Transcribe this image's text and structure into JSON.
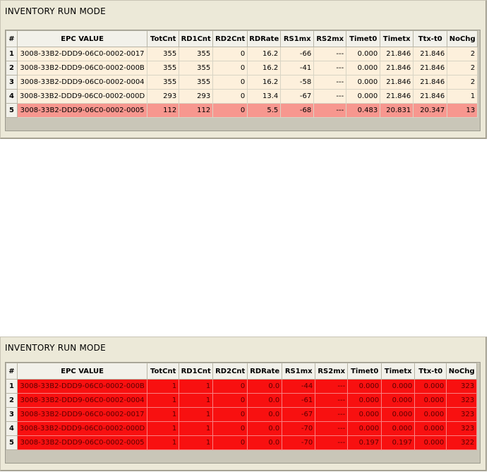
{
  "columns": [
    "#",
    "EPC VALUE",
    "TotCnt",
    "RD1Cnt",
    "RD2Cnt",
    "RDRate",
    "RS1mx",
    "RS2mx",
    "Timet0",
    "Timetx",
    "Ttx-t0",
    "NoChg"
  ],
  "colors": {
    "panel_bg": "#ece9d8",
    "row_bg": "#fdf0dc",
    "alert_row_bg": "#f7978f",
    "stale_row_bg": "#f81010"
  },
  "top_panel": {
    "title": "INVENTORY RUN MODE",
    "rows": [
      {
        "n": "1",
        "epc": "3008-33B2-DDD9-06C0-0002-0017",
        "totcnt": "355",
        "rd1": "355",
        "rd2": "0",
        "rdrate": "16.2",
        "rs1": "-66",
        "rs2": "---",
        "t0": "0.000",
        "tx": "21.846",
        "ttx": "21.846",
        "nochg": "2"
      },
      {
        "n": "2",
        "epc": "3008-33B2-DDD9-06C0-0002-000B",
        "totcnt": "355",
        "rd1": "355",
        "rd2": "0",
        "rdrate": "16.2",
        "rs1": "-41",
        "rs2": "---",
        "t0": "0.000",
        "tx": "21.846",
        "ttx": "21.846",
        "nochg": "2"
      },
      {
        "n": "3",
        "epc": "3008-33B2-DDD9-06C0-0002-0004",
        "totcnt": "355",
        "rd1": "355",
        "rd2": "0",
        "rdrate": "16.2",
        "rs1": "-58",
        "rs2": "---",
        "t0": "0.000",
        "tx": "21.846",
        "ttx": "21.846",
        "nochg": "2"
      },
      {
        "n": "4",
        "epc": "3008-33B2-DDD9-06C0-0002-000D",
        "totcnt": "293",
        "rd1": "293",
        "rd2": "0",
        "rdrate": "13.4",
        "rs1": "-67",
        "rs2": "---",
        "t0": "0.000",
        "tx": "21.846",
        "ttx": "21.846",
        "nochg": "1"
      },
      {
        "n": "5",
        "epc": "3008-33B2-DDD9-06C0-0002-0005",
        "totcnt": "112",
        "rd1": "112",
        "rd2": "0",
        "rdrate": "5.5",
        "rs1": "-68",
        "rs2": "---",
        "t0": "0.483",
        "tx": "20.831",
        "ttx": "20.347",
        "nochg": "13"
      }
    ]
  },
  "bottom_panel": {
    "title": "INVENTORY RUN MODE",
    "rows": [
      {
        "n": "1",
        "epc": "3008-33B2-DDD9-06C0-0002-000B",
        "totcnt": "1",
        "rd1": "1",
        "rd2": "0",
        "rdrate": "0.0",
        "rs1": "-44",
        "rs2": "---",
        "t0": "0.000",
        "tx": "0.000",
        "ttx": "0.000",
        "nochg": "323"
      },
      {
        "n": "2",
        "epc": "3008-33B2-DDD9-06C0-0002-0004",
        "totcnt": "1",
        "rd1": "1",
        "rd2": "0",
        "rdrate": "0.0",
        "rs1": "-61",
        "rs2": "---",
        "t0": "0.000",
        "tx": "0.000",
        "ttx": "0.000",
        "nochg": "323"
      },
      {
        "n": "3",
        "epc": "3008-33B2-DDD9-06C0-0002-0017",
        "totcnt": "1",
        "rd1": "1",
        "rd2": "0",
        "rdrate": "0.0",
        "rs1": "-67",
        "rs2": "---",
        "t0": "0.000",
        "tx": "0.000",
        "ttx": "0.000",
        "nochg": "323"
      },
      {
        "n": "4",
        "epc": "3008-33B2-DDD9-06C0-0002-000D",
        "totcnt": "1",
        "rd1": "1",
        "rd2": "0",
        "rdrate": "0.0",
        "rs1": "-70",
        "rs2": "---",
        "t0": "0.000",
        "tx": "0.000",
        "ttx": "0.000",
        "nochg": "323"
      },
      {
        "n": "5",
        "epc": "3008-33B2-DDD9-06C0-0002-0005",
        "totcnt": "1",
        "rd1": "1",
        "rd2": "0",
        "rdrate": "0.0",
        "rs1": "-70",
        "rs2": "---",
        "t0": "0.197",
        "tx": "0.197",
        "ttx": "0.000",
        "nochg": "322"
      }
    ]
  }
}
